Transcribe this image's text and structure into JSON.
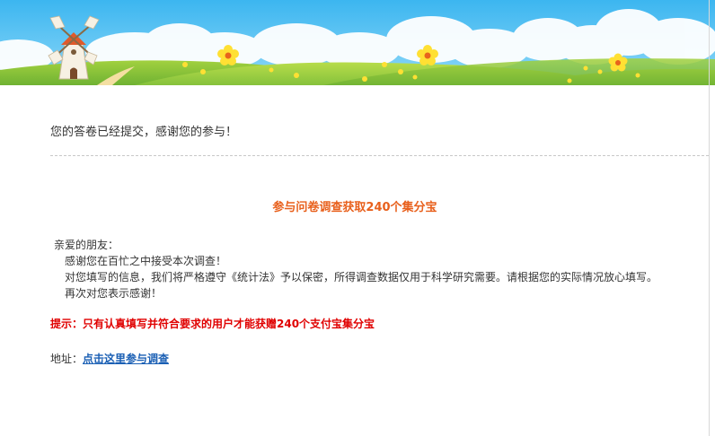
{
  "banner": {
    "sky_color": "#5bc7f5",
    "grass_color": "#8dc63f",
    "icons": [
      "windmill-icon",
      "flower-icon"
    ]
  },
  "thanks_message": "您的答卷已经提交，感谢您的参与！",
  "headline": "参与问卷调查获取240个集分宝",
  "letter": {
    "greeting": "亲爱的朋友：",
    "lines": [
      "感谢您在百忙之中接受本次调查！",
      "对您填写的信息，我们将严格遵守《统计法》予以保密，所得调查数据仅用于科学研究需要。请根据您的实际情况放心填写。",
      "再次对您表示感谢！"
    ]
  },
  "tip": "提示：只有认真填写并符合要求的用户才能获赠240个支付宝集分宝",
  "address": {
    "label": "地址：",
    "link_text": "点击这里参与调查"
  },
  "colors": {
    "headline": "#e8601c",
    "tip": "#e00000",
    "link": "#1a5fb4"
  }
}
